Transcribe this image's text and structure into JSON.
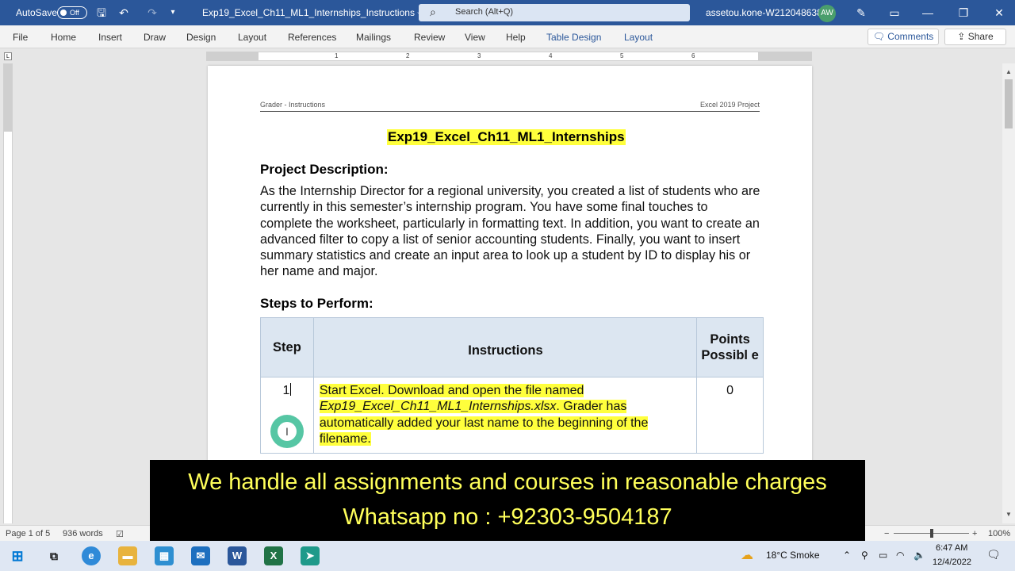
{
  "titlebar": {
    "autosave_label": "AutoSave",
    "autosave_state": "Off",
    "doc_title": "Exp19_Excel_Ch11_ML1_Internships_Instructions ⌵",
    "search_placeholder": "Search (Alt+Q)",
    "account": "assetou.kone-W212048638",
    "avatar_initials": "AW"
  },
  "ribbon": {
    "tabs": [
      "File",
      "Home",
      "Insert",
      "Draw",
      "Design",
      "Layout",
      "References",
      "Mailings",
      "Review",
      "View",
      "Help",
      "Table Design",
      "Layout"
    ],
    "comments_label": "Comments",
    "share_label": "Share"
  },
  "ruler": {
    "numbers": [
      "1",
      "2",
      "3",
      "4",
      "5",
      "6"
    ]
  },
  "document": {
    "header_left": "Grader - Instructions",
    "header_right": "Excel 2019 Project",
    "title": "Exp19_Excel_Ch11_ML1_Internships",
    "project_desc_heading": "Project Description:",
    "project_desc": "As the Internship Director for a regional university, you created a list of students who are currently in this semester’s internship program. You have some final touches to complete the worksheet, particularly in formatting text. In addition, you want to create an advanced filter to copy a list of senior accounting students. Finally, you want to insert summary statistics and create an input area to look up a student by ID to display his or her name and major.",
    "steps_heading": "Steps to Perform:",
    "table": {
      "headers": [
        "Step",
        "Instructions",
        "Points Possibl e"
      ],
      "rows": [
        {
          "step": "1",
          "ins_part1": "Start Excel. Download and open the file named ",
          "ins_italic": "Exp19_Excel_Ch11_ML1_Internships.xlsx",
          "ins_part2": ". Grader has automatically added your last name to the beginning of the filename.",
          "points": "0"
        }
      ]
    }
  },
  "statusbar": {
    "page": "Page 1 of 5",
    "words": "936 words",
    "zoom": "100%"
  },
  "caption": {
    "line1": "We handle all assignments and courses in reasonable charges",
    "line2": "Whatsapp no : +92303-9504187"
  },
  "taskbar": {
    "weather": "18°C  Smoke",
    "time": "6:47 AM",
    "date": "12/4/2022"
  },
  "colors": {
    "word_blue": "#2b579a",
    "highlight_yellow": "#ffff3c",
    "table_header": "#dce6f1",
    "caption_text": "#ffff5a"
  }
}
